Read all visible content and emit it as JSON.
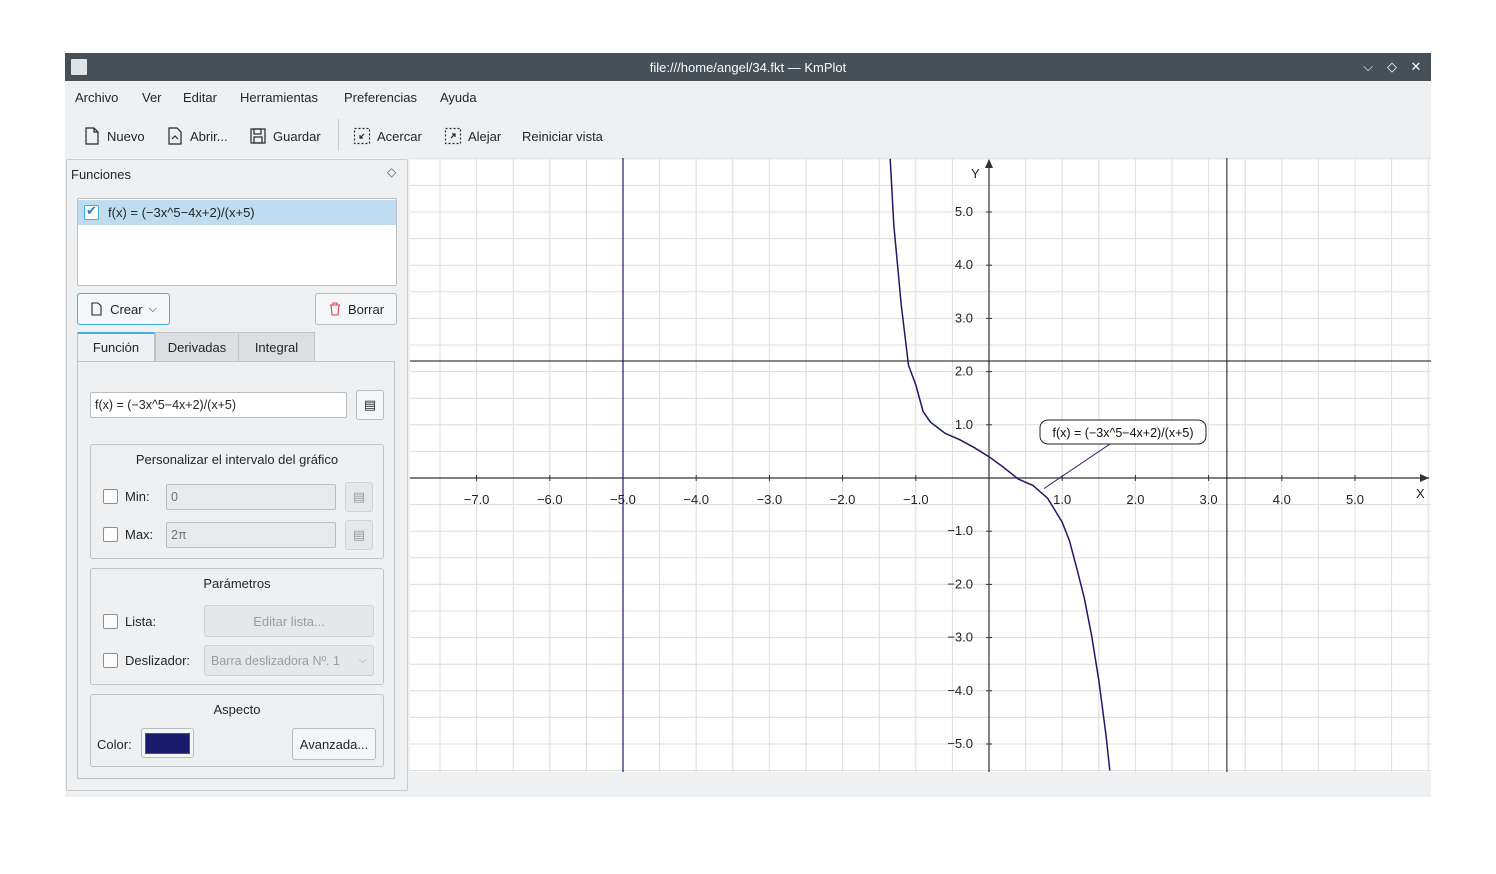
{
  "window": {
    "title": "file:///home/angel/34.fkt — KmPlot"
  },
  "menubar": [
    "Archivo",
    "Ver",
    "Editar",
    "Herramientas",
    "Preferencias",
    "Ayuda"
  ],
  "toolbar": {
    "new": "Nuevo",
    "open": "Abrir...",
    "save": "Guardar",
    "zoom_in": "Acercar",
    "zoom_out": "Alejar",
    "reset": "Reiniciar vista"
  },
  "panel": {
    "title": "Funciones",
    "functions": [
      {
        "checked": true,
        "label": "f(x) = (−3x^5−4x+2)/(x+5)"
      }
    ],
    "create_label": "Crear",
    "delete_label": "Borrar",
    "tabs": [
      "Función",
      "Derivadas",
      "Integral"
    ],
    "active_tab": "Función",
    "equation": "f(x) = (−3x^5−4x+2)/(x+5)",
    "interval": {
      "title": "Personalizar el intervalo del gráfico",
      "min_label": "Min:",
      "min_value": "0",
      "min_checked": false,
      "max_label": "Max:",
      "max_value": "2π",
      "max_checked": false
    },
    "params": {
      "title": "Parámetros",
      "list_label": "Lista:",
      "list_checked": false,
      "edit_list_label": "Editar lista...",
      "slider_label": "Deslizador:",
      "slider_checked": false,
      "slider_value": "Barra deslizadora Nº. 1"
    },
    "appearance": {
      "title": "Aspecto",
      "color_label": "Color:",
      "color": "#1a1a6e",
      "advanced_label": "Avanzada..."
    }
  },
  "chart_data": {
    "type": "line",
    "xlabel": "X",
    "ylabel": "Y",
    "xlim": [
      -7.8,
      6.1
    ],
    "ylim": [
      -5.5,
      5.8
    ],
    "x_ticks": [
      "−7.0",
      "−6.0",
      "−5.0",
      "−4.0",
      "−3.0",
      "−2.0",
      "−1.0",
      "1.0",
      "2.0",
      "3.0",
      "4.0",
      "5.0"
    ],
    "y_ticks": [
      "5.0",
      "4.0",
      "3.0",
      "2.0",
      "1.0",
      "−1.0",
      "−2.0",
      "−3.0",
      "−4.0",
      "−5.0"
    ],
    "grid": true,
    "series": [
      {
        "name": "f(x) = (−3x^5−4x+2)/(x+5)",
        "color": "#1a1a6e",
        "x": [
          -1.35,
          -1.3,
          -1.2,
          -1.1,
          -1.0,
          -0.9,
          -0.8,
          -0.6,
          -0.4,
          -0.2,
          0.0,
          0.2,
          0.4,
          0.6,
          0.8,
          1.0,
          1.1,
          1.2,
          1.3,
          1.4,
          1.5,
          1.6,
          1.65
        ],
        "y": [
          6.0,
          4.76,
          3.26,
          2.12,
          1.75,
          1.25,
          1.05,
          0.84,
          0.72,
          0.57,
          0.4,
          0.2,
          -0.02,
          -0.14,
          -0.38,
          -0.83,
          -1.18,
          -1.7,
          -2.25,
          -2.95,
          -3.8,
          -4.85,
          -5.5
        ]
      }
    ],
    "annotation": "f(x) = (−3x^5−4x+2)/(x+5)",
    "crosshair": {
      "x": 3.25,
      "y": 2.2
    },
    "asymptote_x": -5.0
  }
}
